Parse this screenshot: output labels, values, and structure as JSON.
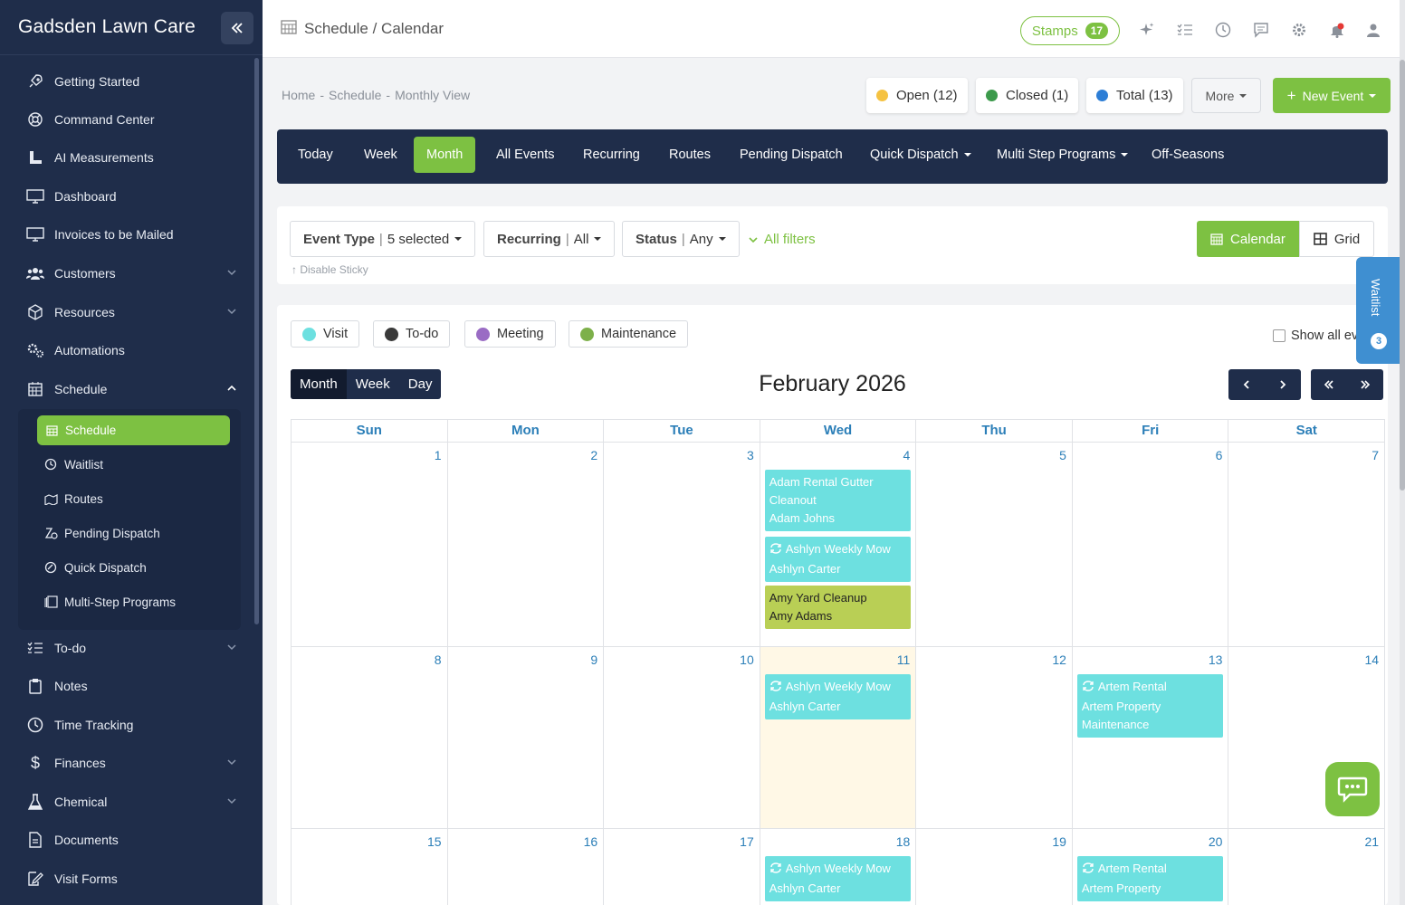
{
  "sidebar": {
    "brand": "Gadsden Lawn Care",
    "items": [
      {
        "label": "Getting Started"
      },
      {
        "label": "Command Center"
      },
      {
        "label": "AI Measurements"
      },
      {
        "label": "Dashboard"
      },
      {
        "label": "Invoices to be Mailed"
      },
      {
        "label": "Customers"
      },
      {
        "label": "Resources"
      },
      {
        "label": "Automations"
      },
      {
        "label": "Schedule"
      },
      {
        "label": "To-do"
      },
      {
        "label": "Notes"
      },
      {
        "label": "Time Tracking"
      },
      {
        "label": "Finances"
      },
      {
        "label": "Chemical"
      },
      {
        "label": "Documents"
      },
      {
        "label": "Visit Forms"
      }
    ],
    "schedule_sub": [
      {
        "label": "Schedule"
      },
      {
        "label": "Waitlist"
      },
      {
        "label": "Routes"
      },
      {
        "label": "Pending Dispatch"
      },
      {
        "label": "Quick Dispatch"
      },
      {
        "label": "Multi-Step Programs"
      }
    ]
  },
  "topbar": {
    "title": "Schedule / Calendar",
    "stamps_label": "Stamps",
    "stamps_count": "17"
  },
  "breadcrumb": {
    "home": "Home",
    "schedule": "Schedule",
    "current": "Monthly View",
    "sep": "-"
  },
  "status": {
    "open": "Open (12)",
    "closed": "Closed (1)",
    "total": "Total (13)",
    "more": "More",
    "new_event": "New Event"
  },
  "tabs": [
    "Today",
    "Week",
    "Month",
    "All Events",
    "Recurring",
    "Routes",
    "Pending Dispatch",
    "Quick Dispatch",
    "Multi Step Programs",
    "Off-Seasons"
  ],
  "filters": {
    "event_type_label": "Event Type",
    "event_type_value": "5 selected",
    "recurring_label": "Recurring",
    "recurring_value": "All",
    "status_label": "Status",
    "status_value": "Any",
    "all_filters": "All filters",
    "disable_sticky": "Disable Sticky",
    "calendar_view": "Calendar",
    "grid_view": "Grid"
  },
  "legend": {
    "visit": "Visit",
    "todo": "To-do",
    "meeting": "Meeting",
    "maintenance": "Maintenance",
    "show_all": "Show all ev"
  },
  "colors": {
    "accent": "#7dc142",
    "navy": "#1f2d4a",
    "visit": "#6de0e0",
    "todo": "#3a3a3a",
    "meeting": "#9a6cc4",
    "maintenance": "#7db04a",
    "open": "#f5c242",
    "closed": "#3c9a4b",
    "total": "#2d7ed6"
  },
  "calendar": {
    "view_buttons": [
      "Month",
      "Week",
      "Day"
    ],
    "title": "February 2026",
    "weekdays": [
      "Sun",
      "Mon",
      "Tue",
      "Wed",
      "Thu",
      "Fri",
      "Sat"
    ],
    "weeks": [
      [
        "1",
        "2",
        "3",
        "4",
        "5",
        "6",
        "7"
      ],
      [
        "8",
        "9",
        "10",
        "11",
        "12",
        "13",
        "14"
      ],
      [
        "15",
        "16",
        "17",
        "18",
        "19",
        "20",
        "21"
      ]
    ],
    "events": {
      "e1_line1": "Adam Rental Gutter",
      "e1_line2": "Cleanout",
      "e1_line3": "Adam Johns",
      "e2_line1": "Ashlyn Weekly Mow",
      "e2_line2": "Ashlyn Carter",
      "e3_line1": "Amy Yard Cleanup",
      "e3_line2": "Amy Adams",
      "e4_line1": "Ashlyn Weekly Mow",
      "e4_line2": "Ashlyn Carter",
      "e5_line1": "Artem Rental",
      "e5_line2": "Artem Property",
      "e5_line3": "Maintenance",
      "e6_line1": "Ashlyn Weekly Mow",
      "e6_line2": "Ashlyn Carter",
      "e7_line1": "Artem Rental",
      "e7_line2": "Artem Property"
    }
  },
  "waitlist": {
    "label": "Waitlist",
    "count": "3"
  }
}
